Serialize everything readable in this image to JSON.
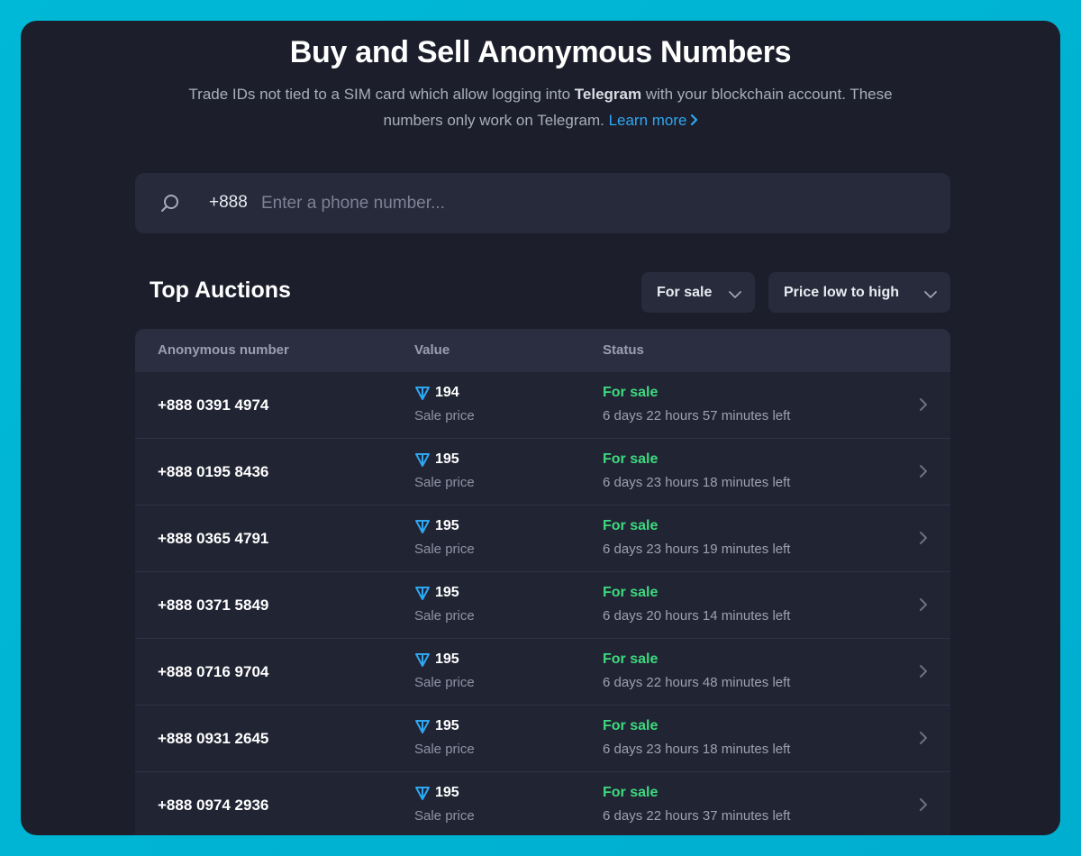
{
  "header": {
    "title": "Buy and Sell Anonymous Numbers",
    "subtitle_part1": "Trade IDs not tied to a SIM card which allow logging into ",
    "subtitle_bold": "Telegram",
    "subtitle_part2": " with your blockchain account. These numbers only work on Telegram. ",
    "learn_more": "Learn more"
  },
  "search": {
    "prefix": "+888",
    "placeholder": "Enter a phone number...",
    "value": ""
  },
  "section": {
    "title": "Top Auctions",
    "filter_label": "For sale",
    "sort_label": "Price low to high"
  },
  "table": {
    "headers": [
      "Anonymous number",
      "Value",
      "Status"
    ],
    "rows": [
      {
        "number": "+888 0391 4974",
        "value": "194",
        "value_sub": "Sale price",
        "status": "For sale",
        "time_left": "6 days 22 hours 57 minutes left"
      },
      {
        "number": "+888 0195 8436",
        "value": "195",
        "value_sub": "Sale price",
        "status": "For sale",
        "time_left": "6 days 23 hours 18 minutes left"
      },
      {
        "number": "+888 0365 4791",
        "value": "195",
        "value_sub": "Sale price",
        "status": "For sale",
        "time_left": "6 days 23 hours 19 minutes left"
      },
      {
        "number": "+888 0371 5849",
        "value": "195",
        "value_sub": "Sale price",
        "status": "For sale",
        "time_left": "6 days 20 hours 14 minutes left"
      },
      {
        "number": "+888 0716 9704",
        "value": "195",
        "value_sub": "Sale price",
        "status": "For sale",
        "time_left": "6 days 22 hours 48 minutes left"
      },
      {
        "number": "+888 0931 2645",
        "value": "195",
        "value_sub": "Sale price",
        "status": "For sale",
        "time_left": "6 days 23 hours 18 minutes left"
      },
      {
        "number": "+888 0974 2936",
        "value": "195",
        "value_sub": "Sale price",
        "status": "For sale",
        "time_left": "6 days 22 hours 37 minutes left"
      }
    ]
  },
  "colors": {
    "accent_link": "#2fa7f0",
    "status_green": "#3ed97f",
    "ton_blue": "#2fa7f0",
    "background": "#1c1e2b"
  },
  "icons": {
    "search": "search-icon",
    "currency": "ton-icon",
    "row_arrow": "chevron-right-icon",
    "dropdown": "chevron-down-icon"
  }
}
